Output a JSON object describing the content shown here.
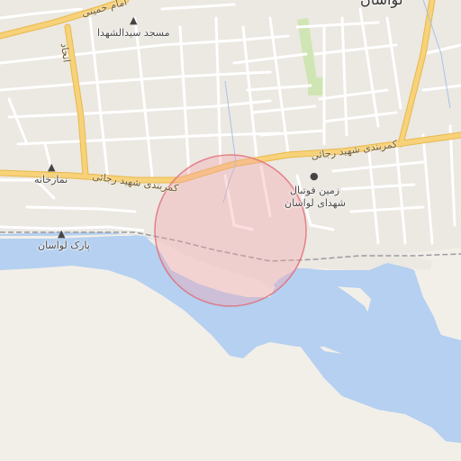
{
  "map": {
    "labels": {
      "road_upper": "امام خمینی",
      "road_vertical": "اتحاد",
      "road_main_1": "کمربندی شهید رجائی",
      "road_main_2": "کمربندی شهید رجائی",
      "mosque": "مسجد سیدالشهدا",
      "prayer_room": "نمازخانه",
      "football_line1": "زمین فوتبال",
      "football_line2": "شهدای لواسان",
      "park": "پارک لواسان",
      "town_partial": "لواسان"
    },
    "icons": {
      "mosque": "mosque-icon",
      "prayer": "prayer-icon",
      "football": "football-icon",
      "park": "tree-icon"
    },
    "colors": {
      "land": "#f2efe9",
      "water": "#b5d0f0",
      "major_road": "#f7d27a",
      "minor_road": "#ffffff",
      "circle_fill": "#f6a0a8",
      "circle_stroke": "#e06a75",
      "green": "#cfe6b4"
    }
  }
}
